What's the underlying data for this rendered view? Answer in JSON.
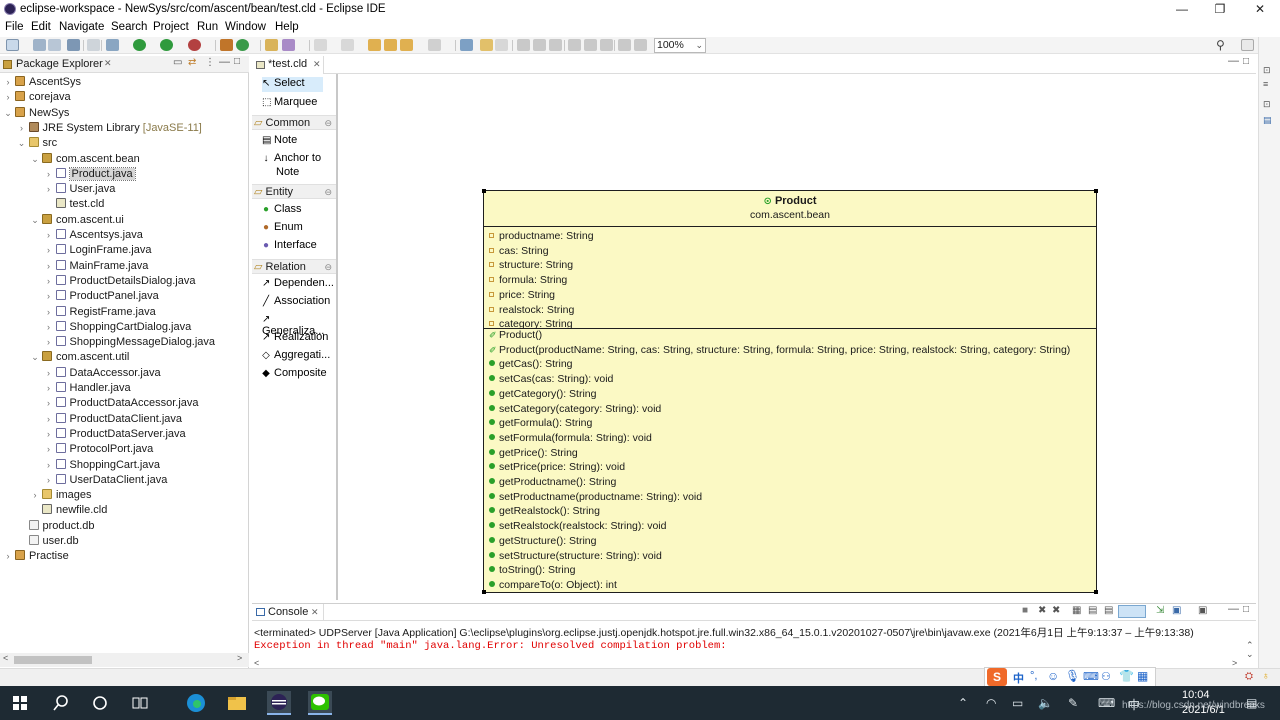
{
  "window": {
    "title": "eclipse-workspace - NewSys/src/com/ascent/bean/test.cld - Eclipse IDE",
    "controls": [
      "—",
      "❐",
      "✕"
    ]
  },
  "menu": [
    "File",
    "Edit",
    "Navigate",
    "Search",
    "Project",
    "Run",
    "Window",
    "Help"
  ],
  "toolbar": {
    "zoom": "100%"
  },
  "package_explorer": {
    "title": "Package Explorer",
    "tree": [
      {
        "label": "AscentSys",
        "depth": 0,
        "twisty": ">",
        "icon": "project"
      },
      {
        "label": "corejava",
        "depth": 0,
        "twisty": ">",
        "icon": "project"
      },
      {
        "label": "NewSys",
        "depth": 0,
        "twisty": "v",
        "icon": "project"
      },
      {
        "label": "JRE System Library",
        "suffix": " [JavaSE-11]",
        "depth": 1,
        "twisty": ">",
        "icon": "library"
      },
      {
        "label": "src",
        "depth": 1,
        "twisty": "v",
        "icon": "folder"
      },
      {
        "label": "com.ascent.bean",
        "depth": 2,
        "twisty": "v",
        "icon": "package"
      },
      {
        "label": "Product.java",
        "depth": 3,
        "twisty": ">",
        "icon": "java",
        "selected": true
      },
      {
        "label": "User.java",
        "depth": 3,
        "twisty": ">",
        "icon": "java"
      },
      {
        "label": "test.cld",
        "depth": 3,
        "twisty": "",
        "icon": "cld"
      },
      {
        "label": "com.ascent.ui",
        "depth": 2,
        "twisty": "v",
        "icon": "package"
      },
      {
        "label": "Ascentsys.java",
        "depth": 3,
        "twisty": ">",
        "icon": "java"
      },
      {
        "label": "LoginFrame.java",
        "depth": 3,
        "twisty": ">",
        "icon": "java"
      },
      {
        "label": "MainFrame.java",
        "depth": 3,
        "twisty": ">",
        "icon": "java"
      },
      {
        "label": "ProductDetailsDialog.java",
        "depth": 3,
        "twisty": ">",
        "icon": "java"
      },
      {
        "label": "ProductPanel.java",
        "depth": 3,
        "twisty": ">",
        "icon": "java"
      },
      {
        "label": "RegistFrame.java",
        "depth": 3,
        "twisty": ">",
        "icon": "java"
      },
      {
        "label": "ShoppingCartDialog.java",
        "depth": 3,
        "twisty": ">",
        "icon": "java"
      },
      {
        "label": "ShoppingMessageDialog.java",
        "depth": 3,
        "twisty": ">",
        "icon": "java"
      },
      {
        "label": "com.ascent.util",
        "depth": 2,
        "twisty": "v",
        "icon": "package"
      },
      {
        "label": "DataAccessor.java",
        "depth": 3,
        "twisty": ">",
        "icon": "java"
      },
      {
        "label": "Handler.java",
        "depth": 3,
        "twisty": ">",
        "icon": "java"
      },
      {
        "label": "ProductDataAccessor.java",
        "depth": 3,
        "twisty": ">",
        "icon": "java"
      },
      {
        "label": "ProductDataClient.java",
        "depth": 3,
        "twisty": ">",
        "icon": "java"
      },
      {
        "label": "ProductDataServer.java",
        "depth": 3,
        "twisty": ">",
        "icon": "java"
      },
      {
        "label": "ProtocolPort.java",
        "depth": 3,
        "twisty": ">",
        "icon": "java"
      },
      {
        "label": "ShoppingCart.java",
        "depth": 3,
        "twisty": ">",
        "icon": "java"
      },
      {
        "label": "UserDataClient.java",
        "depth": 3,
        "twisty": ">",
        "icon": "java"
      },
      {
        "label": "images",
        "depth": 2,
        "twisty": ">",
        "icon": "folder"
      },
      {
        "label": "newfile.cld",
        "depth": 2,
        "twisty": "",
        "icon": "cld"
      },
      {
        "label": "product.db",
        "depth": 1,
        "twisty": "",
        "icon": "db"
      },
      {
        "label": "user.db",
        "depth": 1,
        "twisty": "",
        "icon": "db"
      },
      {
        "label": "Practise",
        "depth": 0,
        "twisty": ">",
        "icon": "project"
      }
    ]
  },
  "editor": {
    "tab": "*test.cld",
    "palette": {
      "top": [
        "Select",
        "Marquee"
      ],
      "drawers": [
        {
          "name": "Common",
          "items": [
            "Note",
            "Anchor to",
            "Note"
          ]
        },
        {
          "name": "Entity",
          "items": [
            "Class",
            "Enum",
            "Interface"
          ]
        },
        {
          "name": "Relation",
          "items": [
            "Dependen...",
            "Association",
            "Generaliza...",
            "Realization",
            "Aggregati...",
            "Composite"
          ]
        }
      ]
    },
    "class_box": {
      "name": "Product",
      "package": "com.ascent.bean",
      "attributes": [
        "productname: String",
        "cas: String",
        "structure: String",
        "formula: String",
        "price: String",
        "realstock: String",
        "category: String"
      ],
      "constructors": [
        "Product()",
        "Product(productName: String, cas: String, structure: String, formula: String, price: String, realstock: String, category: String)"
      ],
      "methods": [
        "getCas(): String",
        "setCas(cas: String): void",
        "getCategory(): String",
        "setCategory(category: String): void",
        "getFormula(): String",
        "setFormula(formula: String): void",
        "getPrice(): String",
        "setPrice(price: String): void",
        "getProductname(): String",
        "setProductname(productname: String): void",
        "getRealstock(): String",
        "setRealstock(realstock: String): void",
        "getStructure(): String",
        "setStructure(structure: String): void",
        "toString(): String",
        "compareTo(o: Object): int"
      ]
    }
  },
  "console": {
    "title": "Console",
    "terminated": "<terminated> UDPServer [Java Application] G:\\eclipse\\plugins\\org.eclipse.justj.openjdk.hotspot.jre.full.win32.x86_64_15.0.1.v20201027-0507\\jre\\bin\\javaw.exe  (2021年6月1日 上午9:13:37 – 上午9:13:38)",
    "error": "Exception in thread \"main\" java.lang.Error: Unresolved compilation problem:"
  },
  "ime": {
    "lang": "中"
  },
  "taskbar": {
    "time": "10:04",
    "date": "2021/6/1",
    "watermark": "https://blog.csdn.net/windbreaks"
  },
  "colors": {
    "class_fill": "#fbf9c4",
    "method_icon": "#2aa02a",
    "error_text": "#e00000",
    "taskbar": "#1e2a33"
  }
}
